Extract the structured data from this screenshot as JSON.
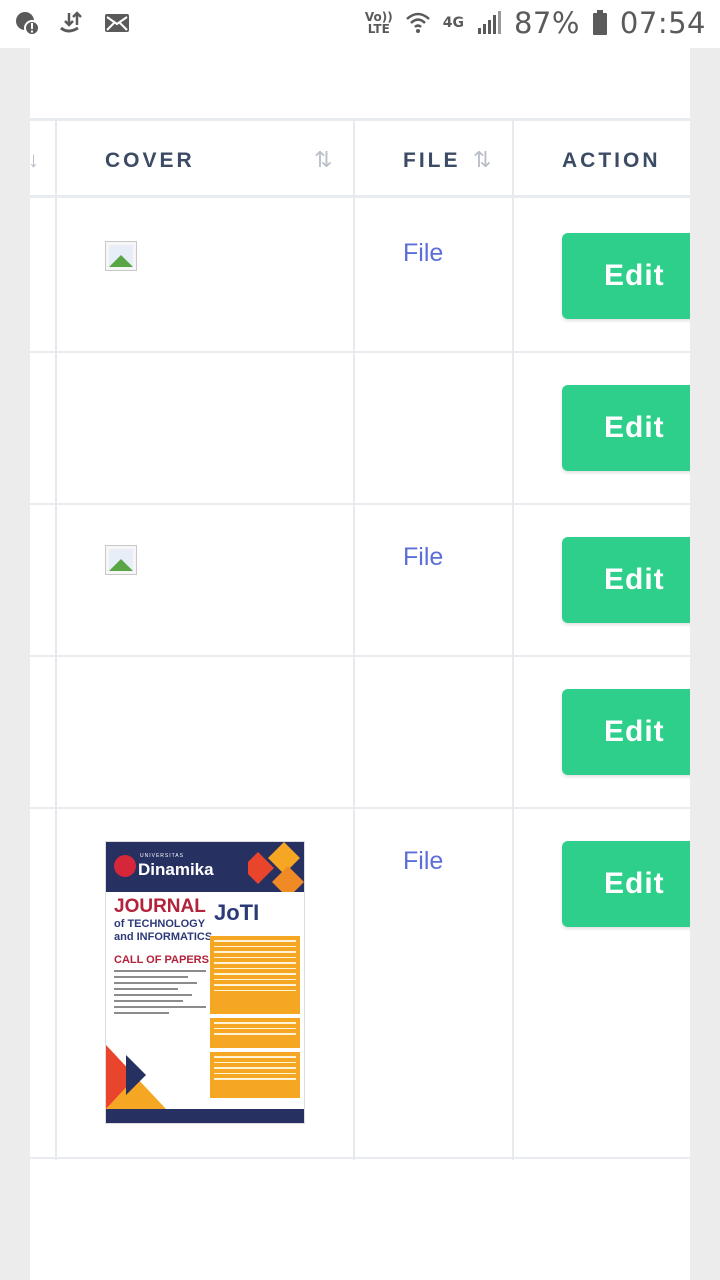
{
  "status_bar": {
    "battery": "87%",
    "time": "07:54",
    "network": "4G",
    "volte_top": "Vo))",
    "volte_bottom": "LTE"
  },
  "table": {
    "columns": [
      {
        "label": "COVER",
        "sortable": true
      },
      {
        "label": "FILE",
        "sortable": true
      },
      {
        "label": "ACTION",
        "sortable": false
      }
    ],
    "rows": [
      {
        "cover": "broken-image",
        "file_label": "File",
        "action_label": "Edit"
      },
      {
        "cover": "none",
        "file_label": "",
        "action_label": "Edit"
      },
      {
        "cover": "broken-image",
        "file_label": "File",
        "action_label": "Edit"
      },
      {
        "cover": "none",
        "file_label": "",
        "action_label": "Edit"
      },
      {
        "cover": "poster",
        "file_label": "File",
        "action_label": "Edit"
      }
    ]
  },
  "poster": {
    "university": "UNIVERSITAS",
    "brand": "Dinamika",
    "journal": "JOURNAL",
    "subtitle_1": "of TECHNOLOGY",
    "subtitle_2": "and INFORMATICS",
    "logo_text": "JoTI",
    "call": "CALL OF PAPERS"
  },
  "colors": {
    "edit_button": "#2ecf8a",
    "link": "#5b6fd6",
    "header_text": "#3c4b64"
  }
}
